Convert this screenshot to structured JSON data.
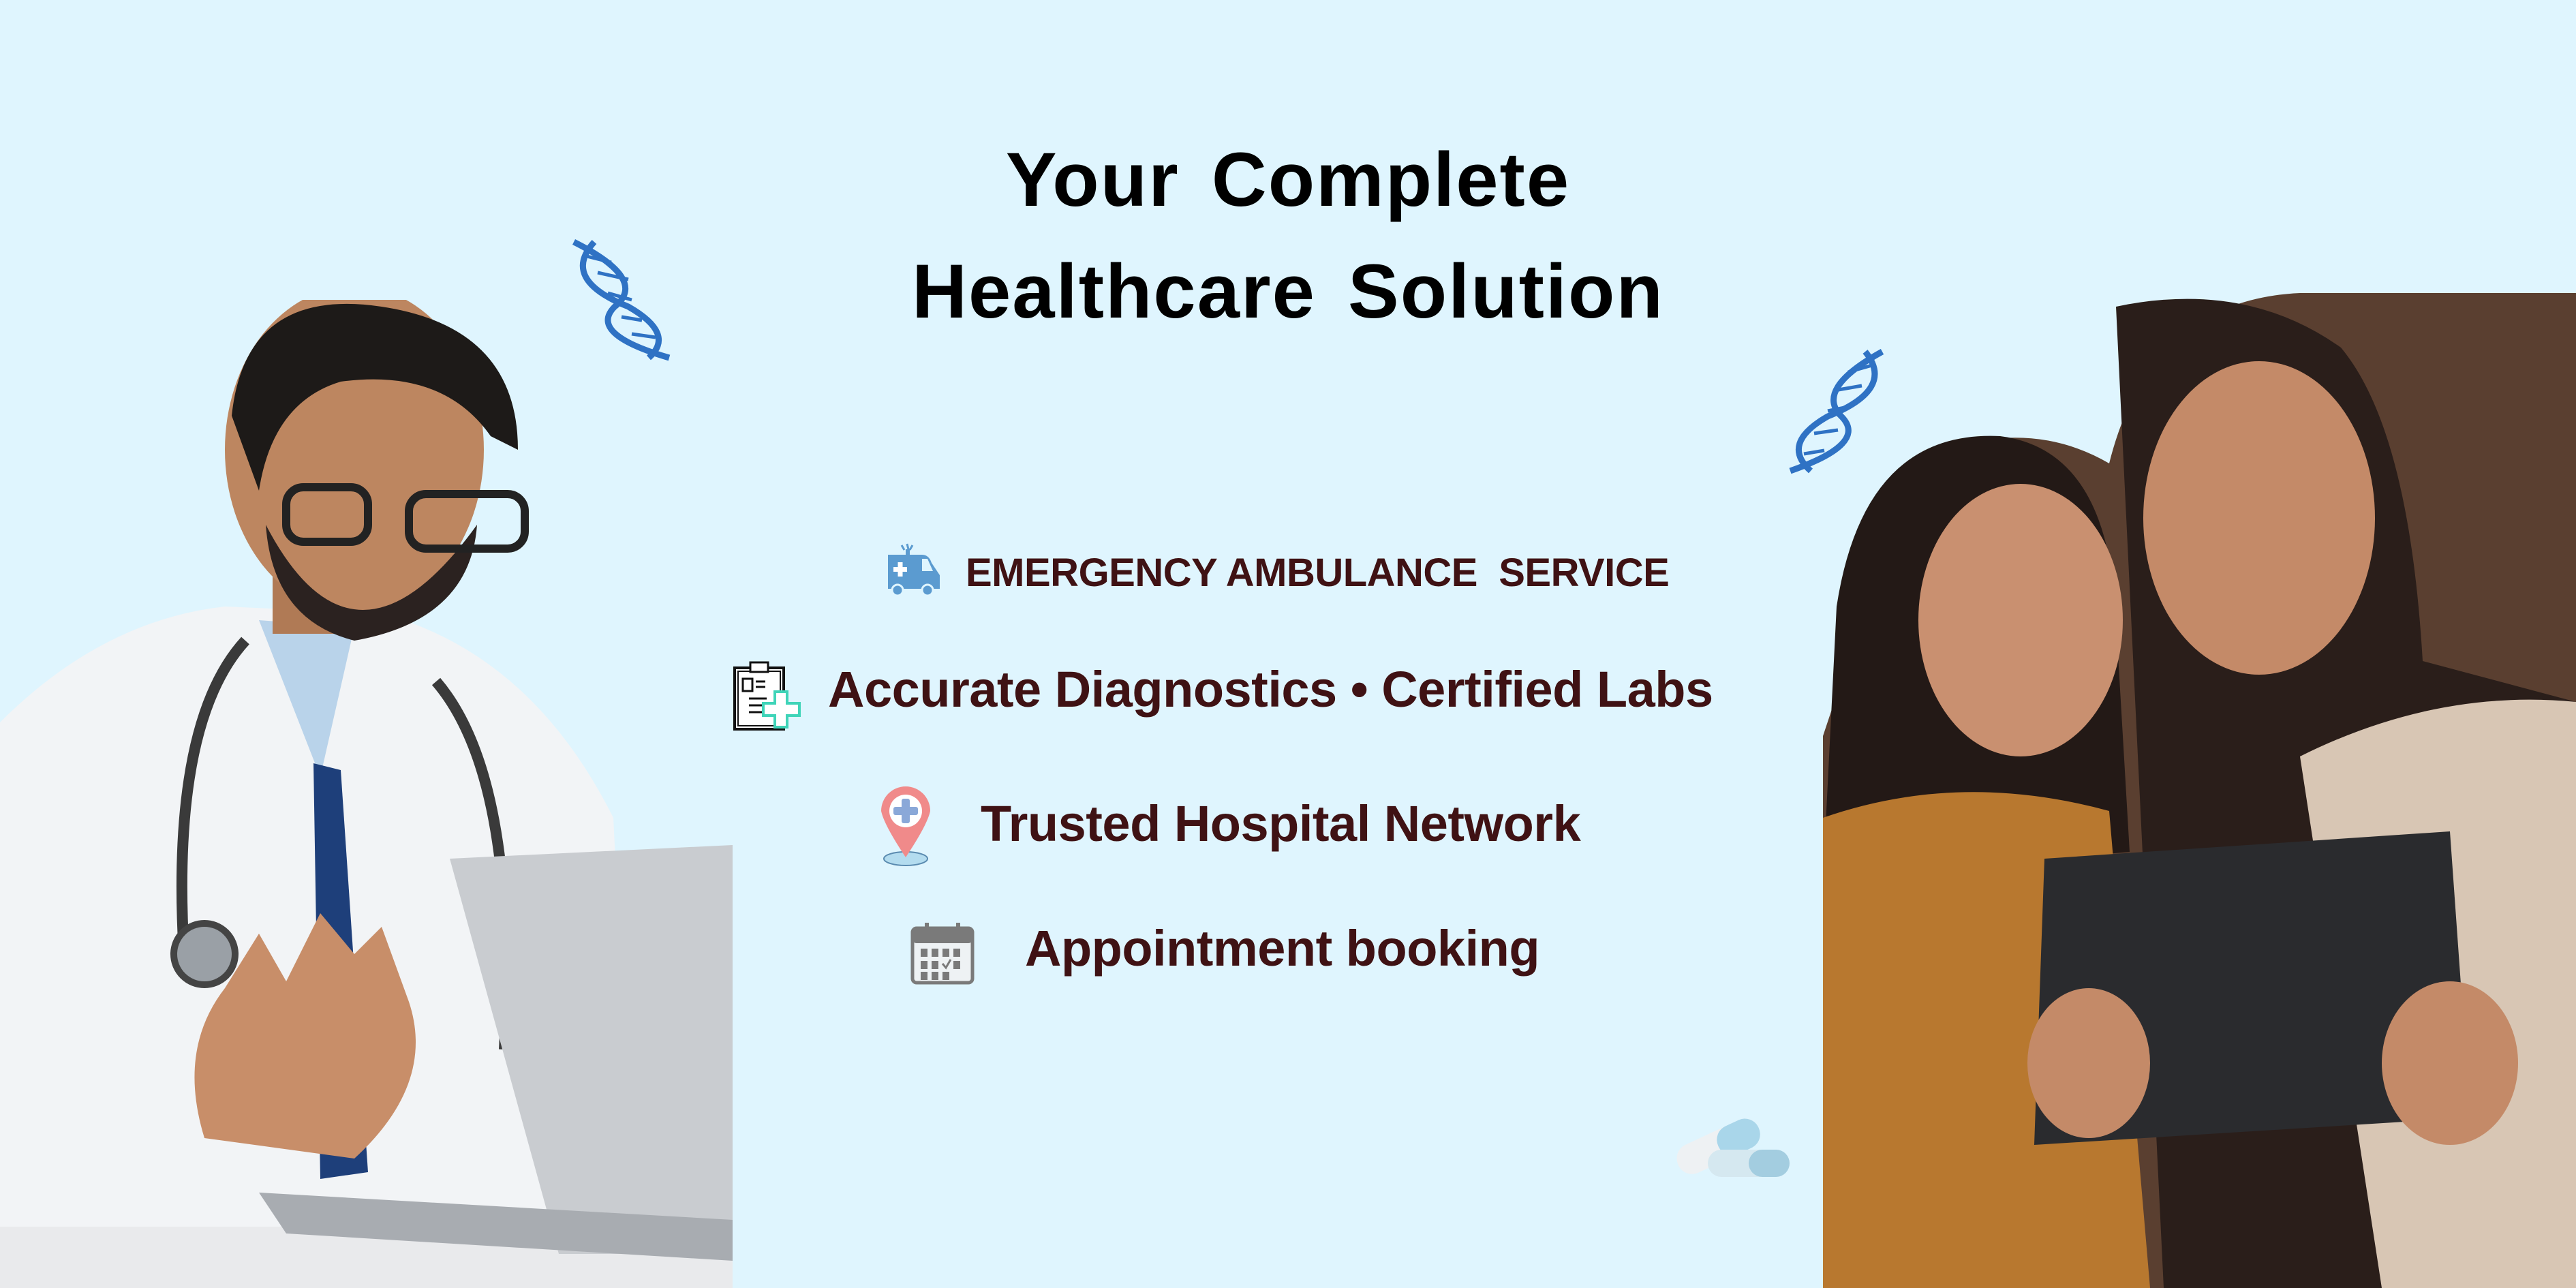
{
  "headline": {
    "line1": "Your Complete",
    "line2": "Healthcare Solution"
  },
  "features": [
    {
      "label": "EMERGENCY AMBULANCE  SERVICE",
      "icon": "ambulance-icon"
    },
    {
      "label": "Accurate Diagnostics • Certified Labs",
      "icon": "clipboard-medical-icon"
    },
    {
      "label": "Trusted Hospital Network",
      "icon": "location-pin-cross-icon"
    },
    {
      "label": "Appointment booking",
      "icon": "calendar-icon"
    }
  ],
  "colors": {
    "background": "#dff5fe",
    "headline": "#000000",
    "feature_text": "#3f1214",
    "icon_blue": "#5b9bd0",
    "dna_blue": "#2f72c4"
  }
}
